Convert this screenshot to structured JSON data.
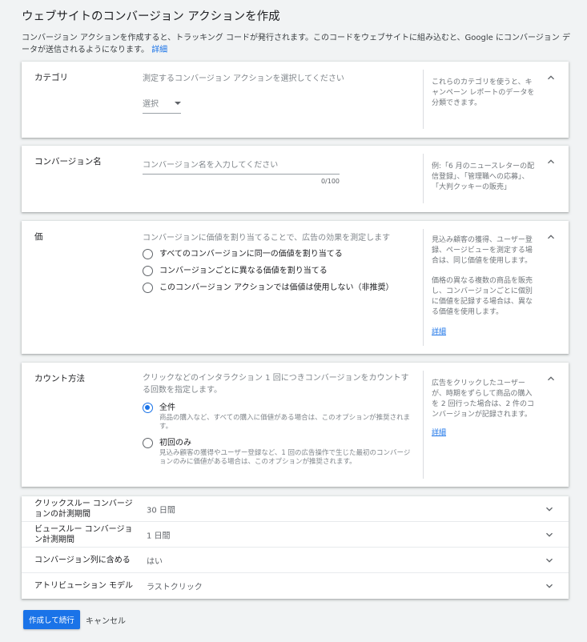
{
  "page": {
    "title": "ウェブサイトのコンバージョン アクションを作成",
    "intro": "コンバージョン アクションを作成すると、トラッキング コードが発行されます。このコードをウェブサイトに組み込むと、Google にコンバージョン データが送信されるようになります。",
    "intro_link": "詳細"
  },
  "category": {
    "label": "カテゴリ",
    "hint": "測定するコンバージョン アクションを選択してください",
    "select_value": "選択",
    "help": "これらのカテゴリを使うと、キャンペーン レポートのデータを分類できます。"
  },
  "conversion_name": {
    "label": "コンバージョン名",
    "placeholder": "コンバージョン名を入力してください",
    "value": "",
    "counter": "0/100",
    "help": "例:「6 月のニュースレターの配信登録」、「管理職への応募」、「大判クッキーの販売」"
  },
  "value": {
    "label": "価",
    "hint": "コンバージョンに価値を割り当てることで、広告の効果を測定します",
    "options": [
      {
        "label": "すべてのコンバージョンに同一の価値を割り当てる",
        "checked": false
      },
      {
        "label": "コンバージョンごとに異なる価値を割り当てる",
        "checked": false
      },
      {
        "label": "このコンバージョン アクションでは価値は使用しない（非推奨）",
        "checked": false
      }
    ],
    "help_1": "見込み顧客の獲得、ユーザー登録、ページビューを測定する場合は、同じ価値を使用します。",
    "help_2": "価格の異なる複数の商品を販売し、コンバージョンごとに個別に価値を記録する場合は、異なる価値を使用します。",
    "help_link": "詳細"
  },
  "count": {
    "label": "カウント方法",
    "hint": "クリックなどのインタラクション 1 回につきコンバージョンをカウントする回数を指定します。",
    "options": [
      {
        "label": "全件",
        "desc": "商品の購入など、すべての購入に価値がある場合は、このオプションが推奨されます。",
        "checked": true
      },
      {
        "label": "初回のみ",
        "desc": "見込み顧客の獲得やユーザー登録など、1 回の広告操作で生じた最初のコンバージョンのみに価値がある場合は、このオプションが推奨されます。",
        "checked": false
      }
    ],
    "help": "広告をクリックしたユーザーが、時期をずらして商品の購入を 2 回行った場合は、2 件のコンバージョンが記録されます。",
    "help_link": "詳細"
  },
  "settings": [
    {
      "name": "クリックスルー コンバージョンの計測期間",
      "value": "30 日間"
    },
    {
      "name": "ビュースルー コンバージョン計測期間",
      "value": "1 日間"
    },
    {
      "name": "コンバージョン列に含める",
      "value": "はい"
    },
    {
      "name": "アトリビューション モデル",
      "value": "ラストクリック"
    }
  ],
  "actions": {
    "primary": "作成して続行",
    "cancel": "キャンセル"
  },
  "icons": {
    "collapse": "chevron-up-icon",
    "expand": "chevron-down-icon"
  },
  "colors": {
    "accent": "#1a73e8"
  }
}
